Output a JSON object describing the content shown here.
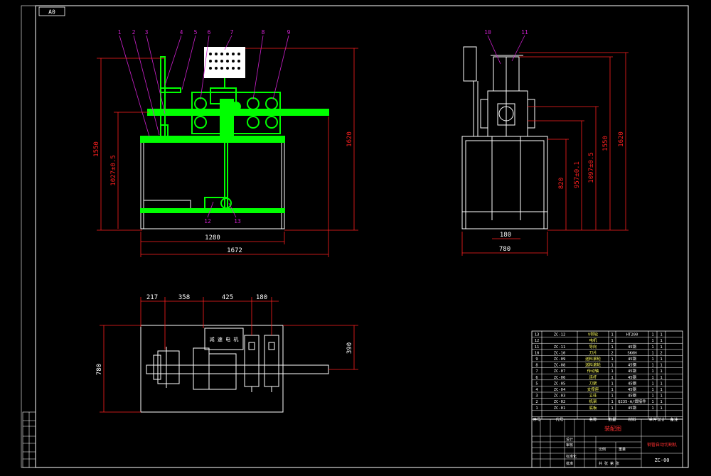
{
  "sheet": {
    "size_label": "A0",
    "drawing_number": "ZC-00",
    "title_label": "装配图",
    "name_label": "钢管自动切割机"
  },
  "colors": {
    "background": "#000000",
    "frame": "#ffffff",
    "part": "#00ff00",
    "dimension": "#ff2020",
    "leader": "#d020d0",
    "table_text": "#00e0ff",
    "title_red": "#ff3030"
  },
  "front_view": {
    "balloons": [
      "1",
      "2",
      "3",
      "4",
      "5",
      "6",
      "7",
      "8",
      "9",
      "10",
      "11",
      "12",
      "13"
    ],
    "dims": {
      "d1550": "1550",
      "d1027": "1027±0.5",
      "d1620": "1620",
      "d1280": "1280",
      "d1672": "1672"
    },
    "bottom_balloons": [
      "12",
      "13"
    ]
  },
  "side_view": {
    "balloons": [
      "10",
      "11"
    ],
    "dims": {
      "d820": "820",
      "d957": "957±0.1",
      "d1097": "1097±0.5",
      "d1550": "1550",
      "d1620": "1620",
      "d180": "180",
      "d780": "780"
    }
  },
  "top_view": {
    "dims": {
      "d217": "217",
      "d358": "358",
      "d425": "425",
      "d180": "180",
      "d390": "390",
      "d780": "780"
    },
    "box_label": "减 速 电 机"
  },
  "bom": {
    "headers": [
      "序号",
      "代号",
      "名称",
      "数量",
      "材料",
      "单件",
      "总计",
      "备注"
    ],
    "rows": [
      [
        "13",
        "ZC-12",
        "V带轮",
        "1",
        "HT200",
        "1",
        "1",
        ""
      ],
      [
        "12",
        "",
        "电机",
        "1",
        "",
        "1",
        "1",
        ""
      ],
      [
        "11",
        "ZC-11",
        "导向",
        "1",
        "45钢",
        "1",
        "1",
        ""
      ],
      [
        "10",
        "ZC-10",
        "刀片",
        "2",
        "SK0H",
        "1",
        "2",
        ""
      ],
      [
        "9",
        "ZC-09",
        "送料滚轮",
        "1",
        "45钢",
        "1",
        "1",
        ""
      ],
      [
        "8",
        "ZC-08",
        "送料滚轮",
        "1",
        "45钢",
        "1",
        "1",
        ""
      ],
      [
        "7",
        "ZC-07",
        "传动轴",
        "1",
        "45钢",
        "1",
        "1",
        ""
      ],
      [
        "6",
        "ZC-06",
        "连杆",
        "1",
        "45钢",
        "1",
        "1",
        ""
      ],
      [
        "5",
        "ZC-05",
        "刀架",
        "1",
        "45钢",
        "1",
        "1",
        ""
      ],
      [
        "4",
        "ZC-04",
        "支撑座",
        "1",
        "45钢",
        "1",
        "1",
        ""
      ],
      [
        "3",
        "ZC-03",
        "立柱",
        "1",
        "45钢",
        "1",
        "1",
        ""
      ],
      [
        "2",
        "ZC-02",
        "机架",
        "1",
        "Q235-A/焊接件",
        "1",
        "1",
        ""
      ],
      [
        "1",
        "ZC-01",
        "底板",
        "1",
        "45钢",
        "1",
        "1",
        ""
      ]
    ]
  },
  "title_block": {
    "design": "设计",
    "check": "审核",
    "standard": "标准化",
    "approve": "批准",
    "scale": "比例",
    "weight": "重量",
    "sheet": "共 张 第 张"
  }
}
